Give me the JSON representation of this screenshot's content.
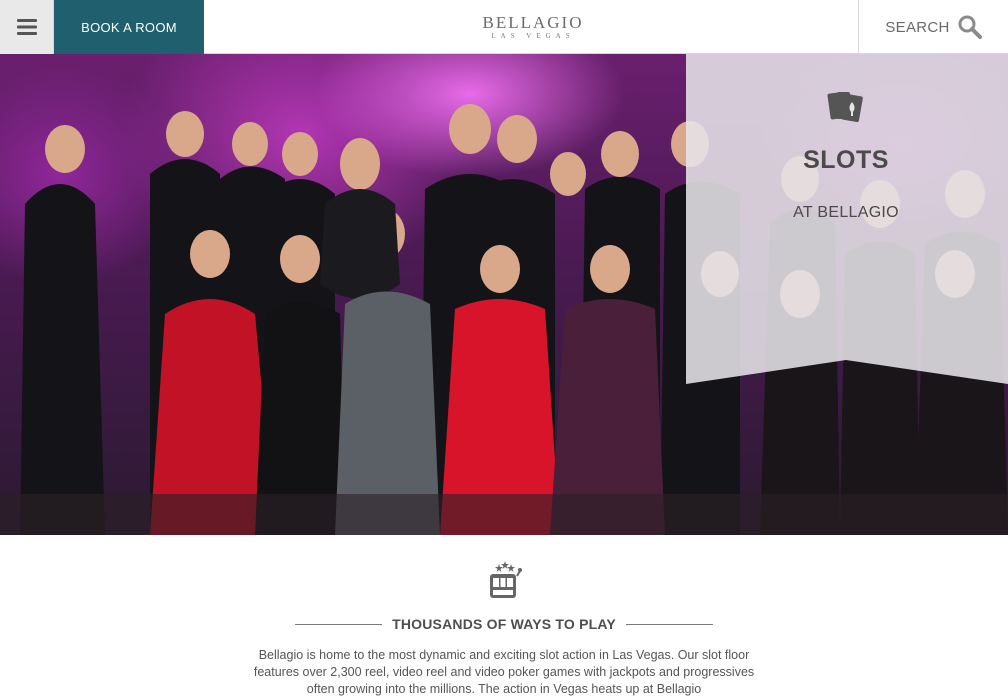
{
  "header": {
    "menu_icon": "hamburger-menu-icon",
    "book_label": "BOOK A ROOM",
    "logo_main": "BELLAGIO",
    "logo_sub": "LAS VEGAS",
    "search_label": "SEARCH",
    "search_icon": "magnifier-icon"
  },
  "hero": {
    "photo": "group-photo-of-guests-in-formal-wear",
    "overlay_icon": "playing-cards-icon",
    "title": "SLOTS",
    "subtitle": "AT BELLAGIO"
  },
  "intro": {
    "icon": "slot-machine-icon",
    "heading": "THOUSANDS OF WAYS TO PLAY",
    "body": "Bellagio is home to the most dynamic and exciting slot action in Las Vegas. Our slot floor features over 2,300 reel, video reel and video poker games with jackpots and progressives often growing into the millions. The action in Vegas heats up at Bellagio"
  },
  "colors": {
    "book_button_bg": "#1f5f6e",
    "menu_button_bg": "#e9e9e9",
    "text": "#4a4a4a"
  }
}
